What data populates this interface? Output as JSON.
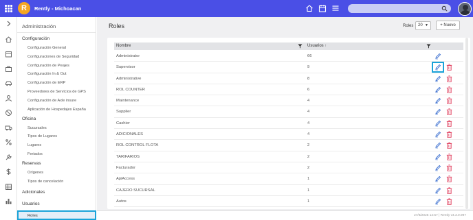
{
  "topbar": {
    "brand_name": "Rently - Michoacan",
    "search_placeholder": ""
  },
  "sidebar": {
    "title": "Administración",
    "sections": [
      {
        "label": "Configuración",
        "items": [
          "Configuración General",
          "Configuraciones de Seguridad",
          "Configuración de Peajes",
          "Configuración In & Out",
          "Configuración de ERP",
          "Proveedores de Servicios de GPS",
          "Configuración de Axle insure",
          "Aplicación de Hospedajes España"
        ]
      },
      {
        "label": "Oficina",
        "items": [
          "Sucursales",
          "Tipos de Lugares",
          "Lugares",
          "Feriados"
        ]
      },
      {
        "label": "Reservas",
        "items": [
          "Orígenes",
          "Tipos de cancelación"
        ]
      },
      {
        "label": "Adicionales",
        "items": []
      },
      {
        "label": "Usuarios",
        "items": []
      }
    ],
    "active_item": "Roles"
  },
  "main": {
    "title": "Roles",
    "page_size_label": "Roles",
    "page_size_value": "20",
    "new_button_label": "Nuevo",
    "columns": {
      "name": "Nombre",
      "users": "Usuarios"
    },
    "rows": [
      {
        "name": "Administrator",
        "users": "66"
      },
      {
        "name": "Supervisor",
        "users": "9"
      },
      {
        "name": "Administrative",
        "users": "8"
      },
      {
        "name": "ROL COUNTER",
        "users": "6"
      },
      {
        "name": "Maintenance",
        "users": "4"
      },
      {
        "name": "Supplier",
        "users": "4"
      },
      {
        "name": "Cashier",
        "users": "4"
      },
      {
        "name": "ADICIONALES",
        "users": "4"
      },
      {
        "name": "ROL CONTROL FLOTA",
        "users": "2"
      },
      {
        "name": "TARIFARIOS",
        "users": "2"
      },
      {
        "name": "Facturador",
        "users": "2"
      },
      {
        "name": "ApiAccess",
        "users": "1"
      },
      {
        "name": "CAJERO SUCURSAL",
        "users": "1"
      },
      {
        "name": "Autos",
        "users": "1"
      }
    ],
    "footer_text": "27/8/2025 14:57 | Rently v4.3.0.997"
  },
  "colors": {
    "topbar": "#4a4fe6",
    "brand_logo": "#f5a623",
    "edit_icon": "#3b6fd0",
    "delete_icon": "#e0405f",
    "highlight": "#1aa3d9"
  },
  "icons": {
    "topbar": [
      "apps-grid-icon",
      "home-icon",
      "calendar-icon",
      "menu-icon",
      "search-icon"
    ],
    "rail": [
      "chevron-right-icon",
      "home-icon",
      "calendar-icon",
      "briefcase-icon",
      "car-icon",
      "user-icon",
      "forbidden-icon",
      "truck-icon",
      "percent-icon",
      "wrench-icon",
      "dollar-icon",
      "table-icon",
      "bar-chart-icon"
    ],
    "row_actions": [
      "edit-icon",
      "trash-icon"
    ]
  }
}
